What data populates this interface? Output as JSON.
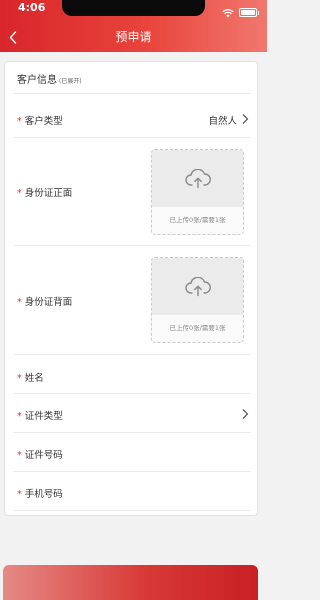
{
  "status_bar": {
    "time": "4:06"
  },
  "nav": {
    "title": "预申请",
    "back_icon": "chevron-left-icon"
  },
  "section": {
    "title": "客户信息",
    "subtitle": "(已展开)"
  },
  "fields": {
    "customer_type": {
      "label": "客户类型",
      "value": "自然人",
      "required": true
    },
    "id_front": {
      "label": "身份证正面",
      "required": true,
      "upload_hint": "已上传0张/需要1张"
    },
    "id_back": {
      "label": "身份证背面",
      "required": true,
      "upload_hint": "已上传0张/需要1张"
    },
    "name": {
      "label": "姓名",
      "required": true
    },
    "id_type": {
      "label": "证件类型",
      "required": true
    },
    "id_number": {
      "label": "证件号码",
      "required": true
    },
    "phone": {
      "label": "手机号码",
      "required": true
    }
  },
  "required_mark": "*",
  "colors": {
    "brand_red": "#d8262a",
    "required_red": "#e0303a"
  }
}
